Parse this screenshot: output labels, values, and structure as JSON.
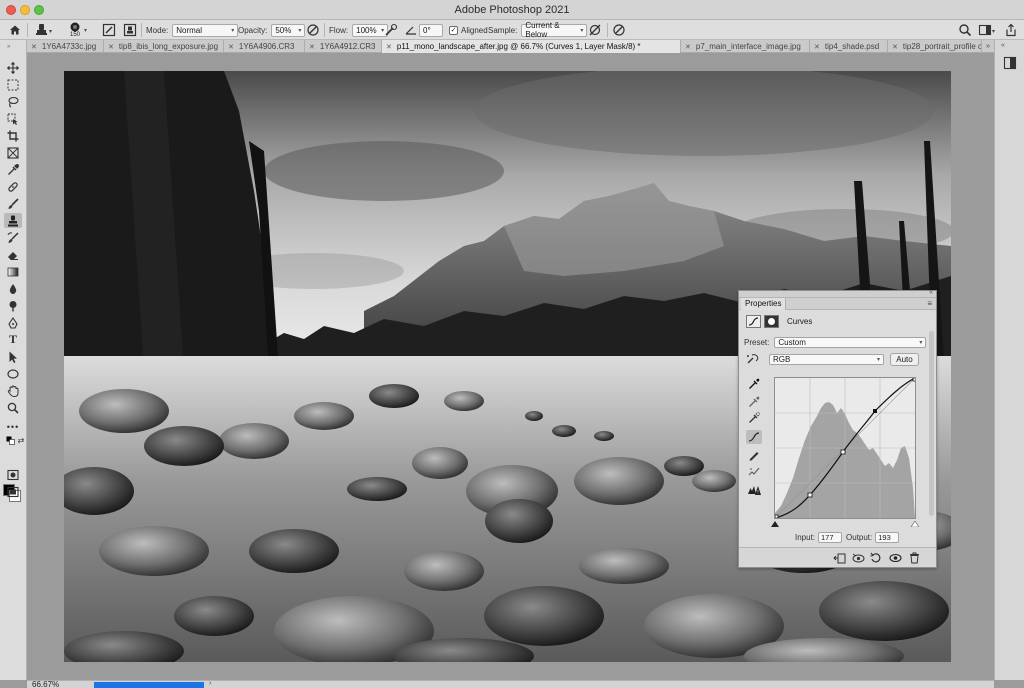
{
  "app": {
    "title": "Adobe Photoshop 2021"
  },
  "options_bar": {
    "brush_size": "150",
    "mode_label": "Mode:",
    "mode_value": "Normal",
    "opacity_label": "Opacity:",
    "opacity_value": "50%",
    "flow_label": "Flow:",
    "flow_value": "100%",
    "angle_value": "0°",
    "aligned_label": "Aligned",
    "aligned_checked": true,
    "sample_label": "Sample:",
    "sample_value": "Current & Below"
  },
  "tabs": [
    {
      "label": "1Y6A4733c.jpg",
      "active": false
    },
    {
      "label": "tip8_ibis_long_exposure.jpg",
      "active": false
    },
    {
      "label": "1Y6A4906.CR3",
      "active": false
    },
    {
      "label": "1Y6A4912.CR3",
      "active": false
    },
    {
      "label": "p11_mono_landscape_after.jpg @ 66.7% (Curves 1, Layer Mask/8) *",
      "active": true
    },
    {
      "label": "p7_main_interface_image.jpg",
      "active": false
    },
    {
      "label": "tip4_shade.psd",
      "active": false
    },
    {
      "label": "tip28_portrait_profile copy.j",
      "active": false
    }
  ],
  "tabs_overflow_icon": "double-chevron-right",
  "properties": {
    "tab_label": "Properties",
    "adjustment_label": "Curves",
    "preset_label": "Preset:",
    "preset_value": "Custom",
    "channel_value": "RGB",
    "auto_label": "Auto",
    "input_label": "Input:",
    "input_value": "177",
    "output_label": "Output:",
    "output_value": "193",
    "bottom_icons": [
      "clip-to-layer-icon",
      "view-previous-icon",
      "reset-icon",
      "visibility-eye-icon",
      "trash-icon"
    ]
  },
  "status": {
    "zoom": "66.67%",
    "progress": 1.0
  }
}
